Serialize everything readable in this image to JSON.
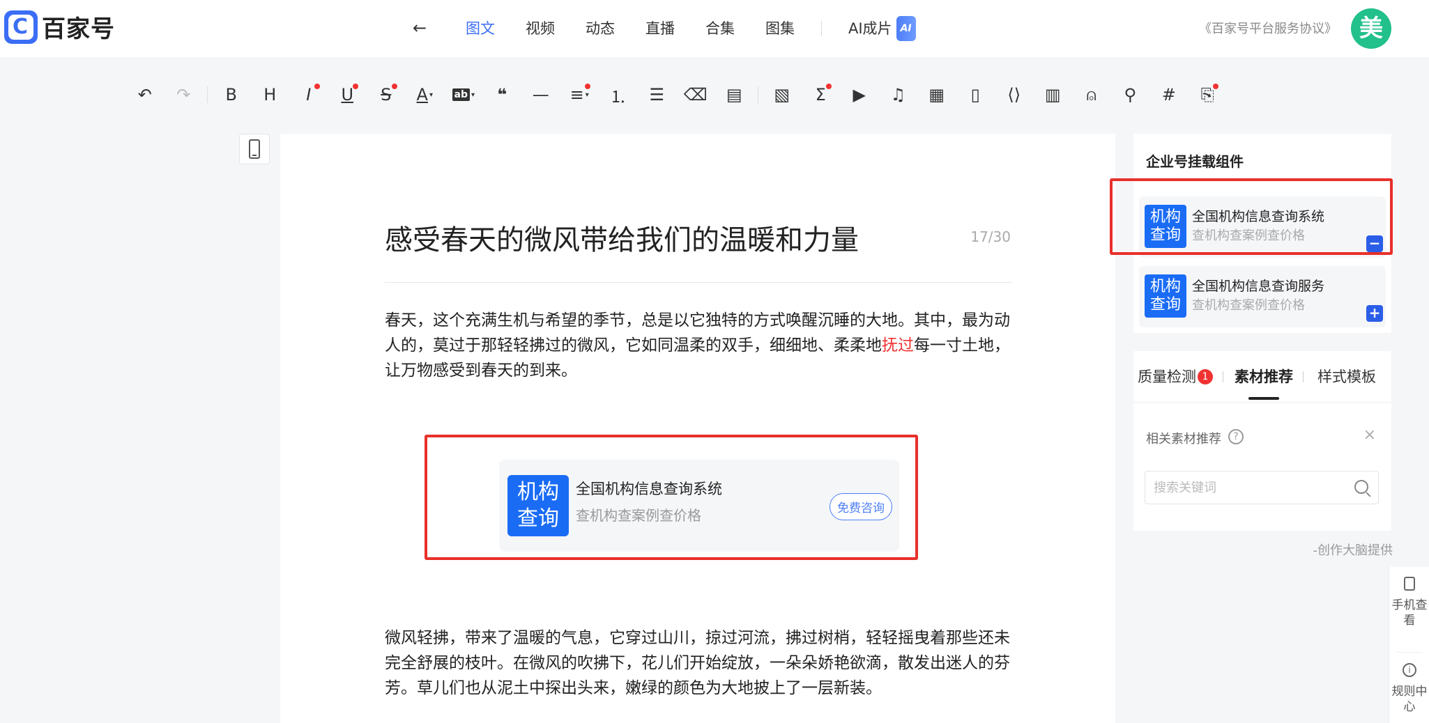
{
  "header": {
    "logo_text": "百家号",
    "tabs": [
      "图文",
      "视频",
      "动态",
      "直播",
      "合集",
      "图集"
    ],
    "ai_tab": "AI成片",
    "ai_badge": "AI",
    "agreement": "《百家号平台服务协议》",
    "avatar_char": "美"
  },
  "toolbar": {
    "bold": "B",
    "heading": "H",
    "italic": "I",
    "underline": "U",
    "strike": "S",
    "color": "A",
    "highlight": "ab",
    "quote": "❝",
    "divider": "—",
    "formula": "Σ",
    "hashtag": "#"
  },
  "editor": {
    "title": "感受春天的微风带给我们的温暖和力量",
    "title_count": "17/30",
    "para1_a": "春天，这个充满生机与希望的季节，总是以它独特的方式唤醒沉睡的大地。其中，最为动人的，莫过于那轻轻拂过的微风，它如同温柔的双手，细细地、柔柔地",
    "para1_hl": "抚过",
    "para1_b": "每一寸土地，让万物感受到春天的到来。",
    "para2": "微风轻拂，带来了温暖的气息，它穿过山川，掠过河流，拂过树梢，轻轻摇曳着那些还未完全舒展的枝叶。在微风的吹拂下，花儿们开始绽放，一朵朵娇艳欲滴，散发出迷人的芬芳。草儿们也从泥土中探出头来，嫩绿的颜色为大地披上了一层新装。",
    "card": {
      "badge": "机构查询",
      "title": "全国机构信息查询系统",
      "subtitle": "查机构查案例查价格",
      "button": "免费咨询"
    }
  },
  "widgets": {
    "title": "企业号挂载组件",
    "items": [
      {
        "badge": "机构查询",
        "title": "全国机构信息查询系统",
        "subtitle": "查机构查案例查价格",
        "action": "−"
      },
      {
        "badge": "机构查询",
        "title": "全国机构信息查询服务",
        "subtitle": "查机构查案例查价格",
        "action": "+"
      }
    ]
  },
  "side_tabs": {
    "tabs": [
      "质量检测",
      "素材推荐",
      "样式模板"
    ],
    "quality_count": "1",
    "related_label": "相关素材推荐",
    "help": "?",
    "close": "×",
    "search_placeholder": "搜索关键词",
    "provider": "-创作大脑提供"
  },
  "float_bar": {
    "mobile_view": "手机查看",
    "rules_center": "规则中心"
  }
}
